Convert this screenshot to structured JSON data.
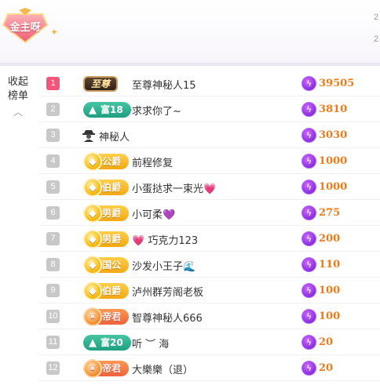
{
  "header": {
    "badge_text": "金主呀",
    "side_numbers": [
      "2",
      "2"
    ]
  },
  "sidebar": {
    "collapse_label": "收起榜单",
    "collapse_chevron": "^"
  },
  "rows": [
    {
      "rank": "1",
      "badge": {
        "style": "zhi",
        "label": "至尊",
        "icon": ""
      },
      "name": "至尊神秘人15",
      "suffix": "",
      "score": "39505"
    },
    {
      "rank": "2",
      "badge": {
        "style": "teal",
        "label": "富18",
        "icon": "wealth-icon"
      },
      "name": "求求你了~",
      "suffix": "",
      "score": "3810"
    },
    {
      "rank": "3",
      "badge": {
        "style": "ghost",
        "label": "",
        "icon": "mystery-user-icon"
      },
      "name": "神秘人",
      "suffix": "",
      "score": "3030"
    },
    {
      "rank": "4",
      "badge": {
        "style": "gold",
        "label": "公爵",
        "icon": "noble-icon"
      },
      "name": "前程修复",
      "suffix": "",
      "score": "1000"
    },
    {
      "rank": "5",
      "badge": {
        "style": "gold",
        "label": "伯爵",
        "icon": "noble-icon"
      },
      "name": "小蛋挞求一束光",
      "suffix": "💗",
      "score": "1000"
    },
    {
      "rank": "6",
      "badge": {
        "style": "gold",
        "label": "男爵",
        "icon": "noble-icon"
      },
      "name": "小可柔",
      "suffix": "💜",
      "score": "275"
    },
    {
      "rank": "7",
      "badge": {
        "style": "gold",
        "label": "男爵",
        "icon": "noble-icon"
      },
      "name": "💗 巧克力123",
      "suffix": "",
      "score": "200"
    },
    {
      "rank": "8",
      "badge": {
        "style": "gold",
        "label": "国公",
        "icon": "noble-icon"
      },
      "name": "沙发小王子",
      "suffix": "🌊",
      "score": "110"
    },
    {
      "rank": "9",
      "badge": {
        "style": "gold",
        "label": "伯爵",
        "icon": "noble-icon"
      },
      "name": "泸州群芳阁老板",
      "suffix": "",
      "score": "100"
    },
    {
      "rank": "10",
      "badge": {
        "style": "orange",
        "label": "帝君",
        "icon": "emperor-icon"
      },
      "name": "智尊神秘人666",
      "suffix": "",
      "score": "100"
    },
    {
      "rank": "11",
      "badge": {
        "style": "teal",
        "label": "富20",
        "icon": "wealth-icon"
      },
      "name": "听 ︶ 海",
      "suffix": "",
      "score": "20"
    },
    {
      "rank": "12",
      "badge": {
        "style": "orange",
        "label": "帝君",
        "icon": "emperor-icon"
      },
      "name": "大樂樂（退）",
      "suffix": "",
      "score": "20"
    }
  ],
  "colors": {
    "rank_first": "#f3567a",
    "rank_default": "#c8c8c8",
    "score": "#f07a17",
    "bolt": "#8a2ce0"
  }
}
